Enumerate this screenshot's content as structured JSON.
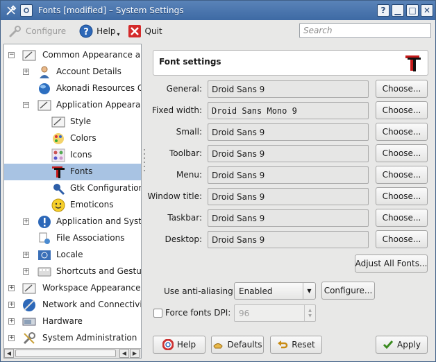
{
  "window": {
    "title": "Fonts [modified] – System Settings"
  },
  "titlebar_buttons": {
    "help": "?",
    "minimize": "▁",
    "maximize": "□",
    "close": "✕"
  },
  "toolbar": {
    "configure_label": "Configure",
    "help_label": "Help",
    "quit_label": "Quit",
    "search_placeholder": "Search"
  },
  "tree": {
    "items": [
      {
        "label": "Common Appearance and",
        "icon": "appearance-icon",
        "expander": "−"
      },
      {
        "label": "Account Details",
        "icon": "user-icon",
        "expander": "+"
      },
      {
        "label": "Akonadi Resources Co",
        "icon": "akonadi-icon",
        "expander": ""
      },
      {
        "label": "Application Appearanc",
        "icon": "appearance-icon",
        "expander": "−"
      },
      {
        "label": "Style",
        "icon": "style-icon",
        "expander": ""
      },
      {
        "label": "Colors",
        "icon": "colors-icon",
        "expander": ""
      },
      {
        "label": "Icons",
        "icon": "icons-icon",
        "expander": ""
      },
      {
        "label": "Fonts",
        "icon": "fonts-icon",
        "expander": ""
      },
      {
        "label": "Gtk Configuration",
        "icon": "gtk-icon",
        "expander": ""
      },
      {
        "label": "Emoticons",
        "icon": "emoticons-icon",
        "expander": ""
      },
      {
        "label": "Application and Systen",
        "icon": "info-icon",
        "expander": "+"
      },
      {
        "label": "File Associations",
        "icon": "file-assoc-icon",
        "expander": ""
      },
      {
        "label": "Locale",
        "icon": "locale-icon",
        "expander": "+"
      },
      {
        "label": "Shortcuts and Gesture",
        "icon": "shortcuts-icon",
        "expander": "+"
      },
      {
        "label": "Workspace Appearance ar",
        "icon": "workspace-icon",
        "expander": "+"
      },
      {
        "label": "Network and Connectivity",
        "icon": "network-icon",
        "expander": "+"
      },
      {
        "label": "Hardware",
        "icon": "hardware-icon",
        "expander": "+"
      },
      {
        "label": "System Administration",
        "icon": "admin-icon",
        "expander": "+"
      }
    ],
    "scroll_left": "◀",
    "scroll_right": "▶"
  },
  "panel": {
    "header_title": "Font settings",
    "fonts": [
      {
        "label": "General:",
        "value": "Droid Sans 9",
        "button": "Choose..."
      },
      {
        "label": "Fixed width:",
        "value": "Droid Sans Mono 9",
        "button": "Choose..."
      },
      {
        "label": "Small:",
        "value": "Droid Sans 9",
        "button": "Choose..."
      },
      {
        "label": "Toolbar:",
        "value": "Droid Sans 9",
        "button": "Choose..."
      },
      {
        "label": "Menu:",
        "value": "Droid Sans 9",
        "button": "Choose..."
      },
      {
        "label": "Window title:",
        "value": "Droid Sans 9",
        "button": "Choose..."
      },
      {
        "label": "Taskbar:",
        "value": "Droid Sans 9",
        "button": "Choose..."
      },
      {
        "label": "Desktop:",
        "value": "Droid Sans 9",
        "button": "Choose..."
      }
    ],
    "adjust_all": "Adjust All Fonts...",
    "antialias_label": "Use anti-aliasing:",
    "antialias_value": "Enabled",
    "configure_button": "Configure...",
    "force_dpi_label": "Force fonts DPI:",
    "force_dpi_value": "96"
  },
  "bottom": {
    "help": "Help",
    "defaults": "Defaults",
    "reset": "Reset",
    "apply": "Apply"
  }
}
